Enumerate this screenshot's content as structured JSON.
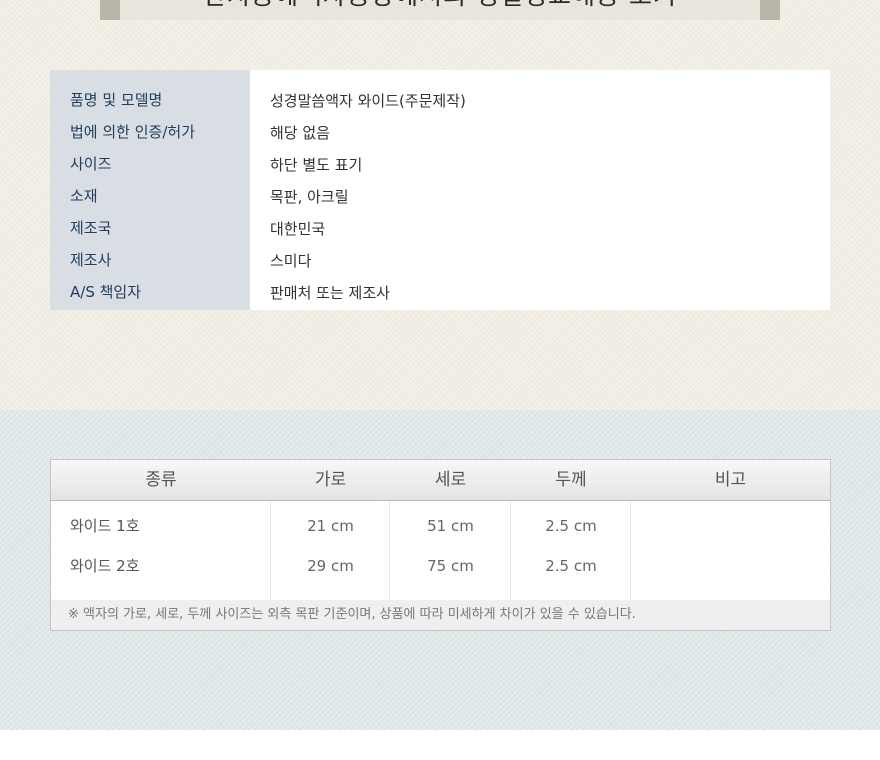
{
  "banner": {
    "title": "한지공예액자공방에서의 정밀정교해공 보기"
  },
  "product_info": [
    {
      "label": "품명 및 모델명",
      "value": "성경말씀액자 와이드(주문제작)"
    },
    {
      "label": "법에 의한 인증/허가",
      "value": "해당 없음"
    },
    {
      "label": "사이즈",
      "value": "하단 별도 표기"
    },
    {
      "label": "소재",
      "value": "목판, 아크릴"
    },
    {
      "label": "제조국",
      "value": "대한민국"
    },
    {
      "label": "제조사",
      "value": "스미다"
    },
    {
      "label": "A/S 책임자",
      "value": "판매처 또는 제조사"
    }
  ],
  "size_table": {
    "headers": [
      "종류",
      "가로",
      "세로",
      "두께",
      "비고"
    ],
    "rows": [
      {
        "type": "와이드 1호",
        "width": "21 cm",
        "height": "51 cm",
        "thickness": "2.5 cm",
        "note": ""
      },
      {
        "type": "와이드 2호",
        "width": "29 cm",
        "height": "75 cm",
        "thickness": "2.5 cm",
        "note": ""
      }
    ],
    "footnote": "※ 액자의 가로, 세로, 두께 사이즈는 외측 목판 기준이며, 상품에 따라 미세하게 차이가 있을 수 있습니다."
  }
}
